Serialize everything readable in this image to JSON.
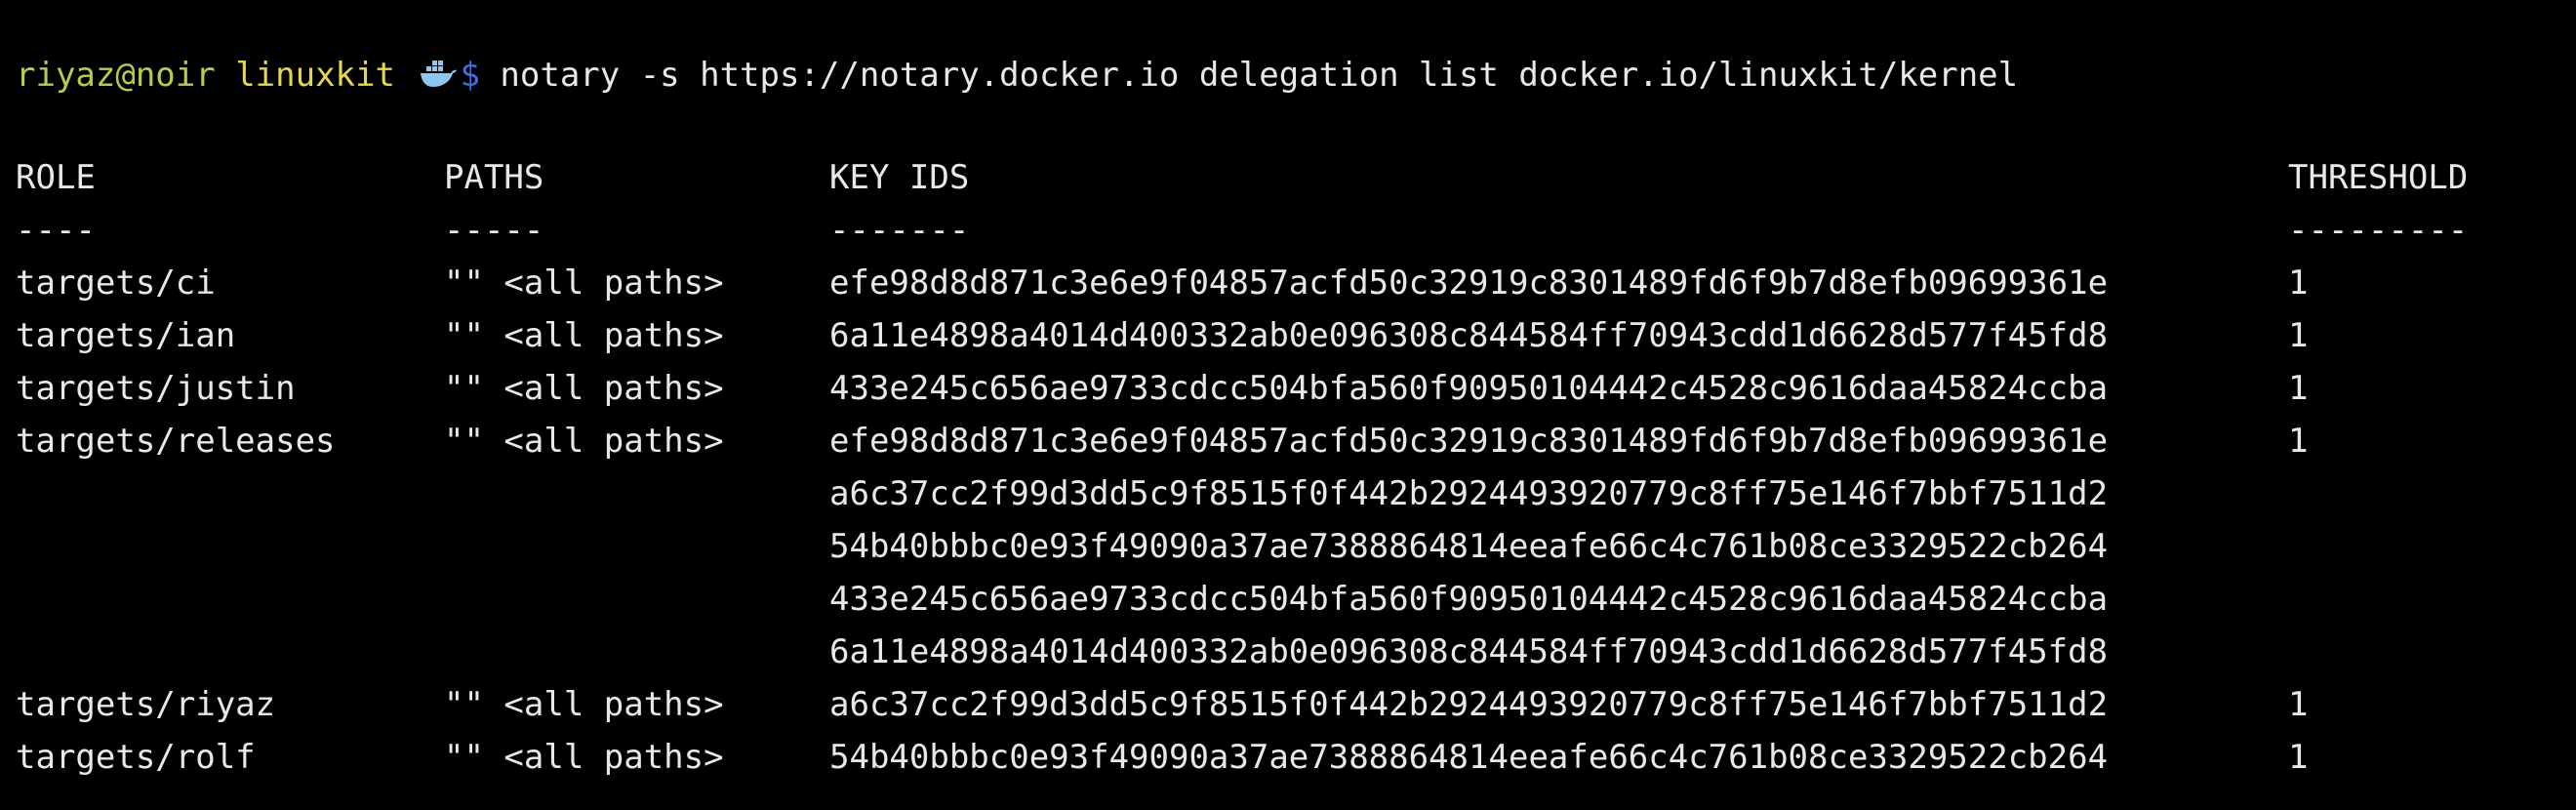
{
  "prompt": {
    "user_host": "riyaz@noir",
    "cwd": "linuxkit",
    "icon": "docker-whale-icon",
    "symbol": "$",
    "command": "notary -s https://notary.docker.io delegation list docker.io/linuxkit/kernel"
  },
  "table": {
    "headers": {
      "role": "ROLE",
      "paths": "PATHS",
      "key_ids": "KEY IDS",
      "threshold": "THRESHOLD"
    },
    "separators": {
      "role": "----",
      "paths": "-----",
      "key_ids": "-------",
      "threshold": "---------"
    },
    "rows": [
      {
        "role": "targets/ci",
        "paths": "\"\" <all paths>",
        "key_id": "efe98d8d871c3e6e9f04857acfd50c32919c8301489fd6f9b7d8efb09699361e",
        "threshold": "1"
      },
      {
        "role": "targets/ian",
        "paths": "\"\" <all paths>",
        "key_id": "6a11e4898a4014d400332ab0e096308c844584ff70943cdd1d6628d577f45fd8",
        "threshold": "1"
      },
      {
        "role": "targets/justin",
        "paths": "\"\" <all paths>",
        "key_id": "433e245c656ae9733cdcc504bfa560f90950104442c4528c9616daa45824ccba",
        "threshold": "1"
      },
      {
        "role": "targets/releases",
        "paths": "\"\" <all paths>",
        "key_id": "efe98d8d871c3e6e9f04857acfd50c32919c8301489fd6f9b7d8efb09699361e",
        "threshold": "1"
      },
      {
        "role": "",
        "paths": "",
        "key_id": "a6c37cc2f99d3dd5c9f8515f0f442b2924493920779c8ff75e146f7bbf7511d2",
        "threshold": ""
      },
      {
        "role": "",
        "paths": "",
        "key_id": "54b40bbbc0e93f49090a37ae7388864814eeafe66c4c761b08ce3329522cb264",
        "threshold": ""
      },
      {
        "role": "",
        "paths": "",
        "key_id": "433e245c656ae9733cdcc504bfa560f90950104442c4528c9616daa45824ccba",
        "threshold": ""
      },
      {
        "role": "",
        "paths": "",
        "key_id": "6a11e4898a4014d400332ab0e096308c844584ff70943cdd1d6628d577f45fd8",
        "threshold": ""
      },
      {
        "role": "targets/riyaz",
        "paths": "\"\" <all paths>",
        "key_id": "a6c37cc2f99d3dd5c9f8515f0f442b2924493920779c8ff75e146f7bbf7511d2",
        "threshold": "1"
      },
      {
        "role": "targets/rolf",
        "paths": "\"\" <all paths>",
        "key_id": "54b40bbbc0e93f49090a37ae7388864814eeafe66c4c761b08ce3329522cb264",
        "threshold": "1"
      }
    ]
  },
  "colors": {
    "background": "#000000",
    "text": "#e8e8e8",
    "user_host": "#b5cc4c",
    "cwd": "#e6d84a",
    "prompt_symbol": "#3f6fe0",
    "whale": "#8fc6f0"
  }
}
